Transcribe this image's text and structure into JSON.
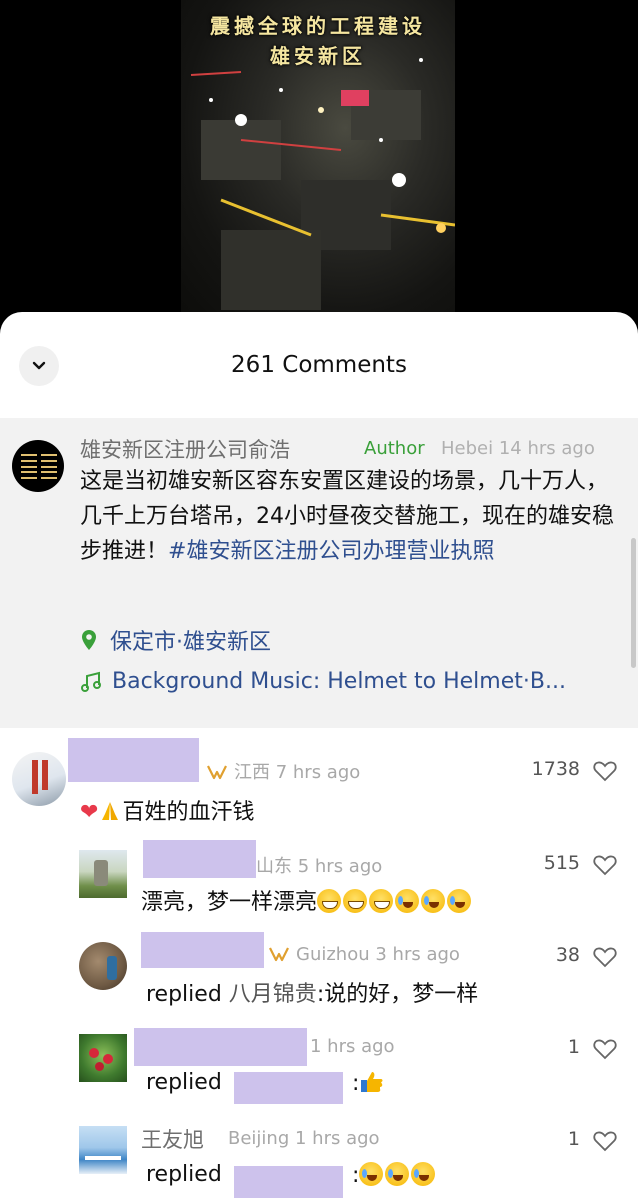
{
  "video": {
    "title_line1": "震撼全球的工程建设",
    "title_line2": "雄安新区"
  },
  "header": {
    "comment_count": "261 Comments",
    "collapse_icon": "chevron-down-icon"
  },
  "post": {
    "author_name": "雄安新区注册公司俞浩",
    "author_tag": "Author",
    "meta": "Hebei 14 hrs ago",
    "body_text": "这是当初雄安新区容东安置区建设的场景，几十万人，几千上万台塔吊，24小时昼夜交替施工，现在的雄安稳步推进！",
    "hashtag": "#雄安新区注册公司办理营业执照",
    "location": "保定市·雄安新区",
    "music": "Background Music: Helmet to Helmet·B..."
  },
  "comments": [
    {
      "meta": "江西 7 hrs ago",
      "likes": "1738",
      "text": "百姓的血汗钱"
    },
    {
      "meta": "山东 5 hrs ago",
      "likes": "515",
      "text": "漂亮，梦一样漂亮"
    },
    {
      "meta": "Guizhou 3 hrs ago",
      "likes": "38",
      "replied_label": "replied",
      "reply_to": "八月锦贵",
      "text": ":说的好，梦一样"
    },
    {
      "meta": "1 hrs ago",
      "likes": "1",
      "replied_label": "replied",
      "text": ":"
    },
    {
      "name": "王友旭",
      "meta": "Beijing 1 hrs ago",
      "likes": "1",
      "replied_label": "replied",
      "text": ":"
    }
  ],
  "colors": {
    "author_green": "#3aa03a",
    "link_blue": "#2f4f8f",
    "redaction": "#cdc2ec"
  }
}
